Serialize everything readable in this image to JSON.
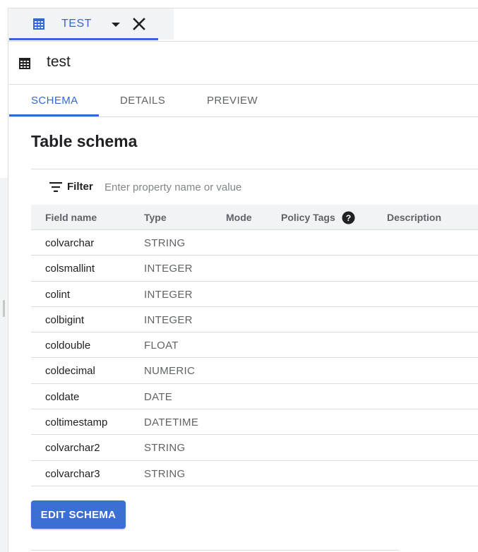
{
  "tab": {
    "label": "TEST"
  },
  "title": "test",
  "subtabs": [
    {
      "label": "SCHEMA"
    },
    {
      "label": "DETAILS"
    },
    {
      "label": "PREVIEW"
    }
  ],
  "section_title": "Table schema",
  "filter": {
    "label": "Filter",
    "placeholder": "Enter property name or value"
  },
  "table": {
    "headers": [
      "Field name",
      "Type",
      "Mode",
      "Policy Tags",
      "Description"
    ],
    "rows": [
      {
        "name": "colvarchar",
        "type": "STRING"
      },
      {
        "name": "colsmallint",
        "type": "INTEGER"
      },
      {
        "name": "colint",
        "type": "INTEGER"
      },
      {
        "name": "colbigint",
        "type": "INTEGER"
      },
      {
        "name": "coldouble",
        "type": "FLOAT"
      },
      {
        "name": "coldecimal",
        "type": "NUMERIC"
      },
      {
        "name": "coldate",
        "type": "DATE"
      },
      {
        "name": "coltimestamp",
        "type": "DATETIME"
      },
      {
        "name": "colvarchar2",
        "type": "STRING"
      },
      {
        "name": "colvarchar3",
        "type": "STRING"
      }
    ]
  },
  "edit_button": "EDIT SCHEMA",
  "icons": {
    "table": "table-grid-icon",
    "dropdown": "arrow-drop-down-icon",
    "close": "close-icon",
    "filter": "filter-list-icon",
    "help": "help-icon"
  },
  "colors": {
    "accent": "#3367d6",
    "button": "#3b6fd4"
  }
}
